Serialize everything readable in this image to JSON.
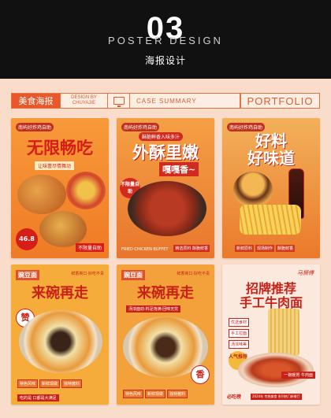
{
  "header": {
    "number": "03",
    "title_en": "POSTER DESIGN",
    "title_cn": "海报设计"
  },
  "strip": {
    "category": "美食海报",
    "design_by_line1": "DESIGN BY",
    "design_by_line2": "CHUYAJIE",
    "case_summary": "CASE SUMMARY",
    "portfolio": "PORTFOLIO",
    "icon": "monitor-icon"
  },
  "posters": [
    {
      "brand": "南屿好炸鸡自助",
      "headline": "无限畅吃",
      "subline": "让味蕾尽情舞动",
      "price": "46.8",
      "badge": "不限量自助"
    },
    {
      "brand": "南屿好炸鸡自助",
      "tag": "酥脆鲜香入味多汁",
      "headline": "外酥里嫩",
      "headline2": "嘎嘎香~",
      "side_badge": "不限量自助",
      "footer_left": "FRIED CHICKEN BUFFET",
      "footer_right": "精选原料 酥脆鲜香"
    },
    {
      "brand": "南屿好炸鸡自助",
      "headline": "好料",
      "headline2": "好味道",
      "chips": [
        "新鲜原料",
        "现场制作",
        "酥脆鲜香"
      ]
    },
    {
      "top_tag": "豌豆面",
      "top_right": "鲜香爽口·好吃不贵",
      "headline": "来碗再走",
      "badge": "赞",
      "chips": [
        "特色风味",
        "新鲜现做",
        "独特酱料"
      ],
      "footer": "吃的是 口都是大满足"
    },
    {
      "top_tag": "豌豆面",
      "top_right": "鲜香爽口·好吃不贵",
      "headline": "来碗再走",
      "ribbon": "汤浓面劲·料足饱满·回味无穷",
      "badge": "香",
      "chips": [
        "特色风味",
        "新鲜现做",
        "独特酱料"
      ]
    },
    {
      "logo": "马狮傅",
      "headline": "招牌推荐",
      "headline2": "手工牛肉面",
      "features": [
        "优选食材",
        "手工拉面",
        "汤浓味美"
      ],
      "badge": "人气推荐",
      "ribbon": "一碗暖胃 牛肉面",
      "footer": "2024年 传统美食 系列热门新餐厅",
      "footer_logo": "必吃榜"
    }
  ],
  "colors": {
    "background": "#f9dcc9",
    "header_bg": "#111111",
    "accent": "#e8582a",
    "headline_red": "#d51e18"
  }
}
